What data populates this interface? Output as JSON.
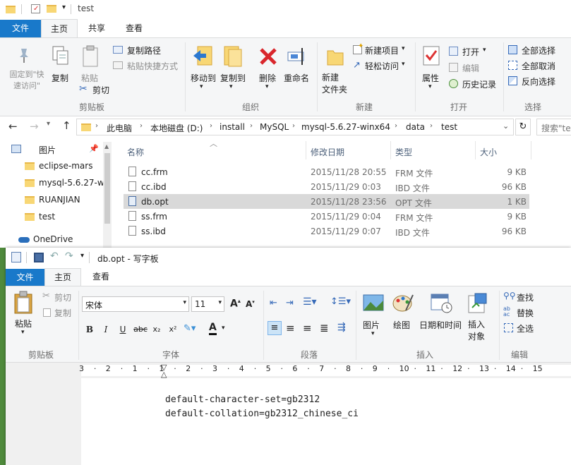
{
  "explorer": {
    "window_title": "test",
    "tabs": [
      "文件",
      "主页",
      "共享",
      "查看"
    ],
    "ribbon": {
      "clipboard": {
        "pin_label": "固定到\"快速访问\"",
        "copy_label": "复制",
        "paste_label": "粘贴",
        "copy_path_label": "复制路径",
        "paste_shortcut_label": "粘贴快捷方式",
        "cut_label": "剪切",
        "group_label": "剪贴板"
      },
      "organize": {
        "move_to_label": "移动到",
        "copy_to_label": "复制到",
        "delete_label": "删除",
        "rename_label": "重命名",
        "group_label": "组织"
      },
      "new": {
        "new_folder_label": "新建\n文件夹",
        "new_item_label": "新建项目",
        "easy_access_label": "轻松访问",
        "group_label": "新建"
      },
      "open": {
        "properties_label": "属性",
        "open_label": "打开",
        "edit_label": "编辑",
        "history_label": "历史记录",
        "group_label": "打开"
      },
      "select": {
        "select_all_label": "全部选择",
        "select_none_label": "全部取消",
        "invert_label": "反向选择",
        "group_label": "选择"
      }
    },
    "breadcrumb": [
      "此电脑",
      "本地磁盘 (D:)",
      "install",
      "MySQL",
      "mysql-5.6.27-winx64",
      "data",
      "test"
    ],
    "search_placeholder": "搜索\"te",
    "nav": [
      {
        "label": "图片",
        "pinned": true
      },
      {
        "label": "eclipse-mars"
      },
      {
        "label": "mysql-5.6.27-w"
      },
      {
        "label": "RUANJIAN"
      },
      {
        "label": "test"
      },
      {
        "label": "OneDrive"
      }
    ],
    "columns": [
      "名称",
      "修改日期",
      "类型",
      "大小"
    ],
    "files": [
      {
        "name": "cc.frm",
        "date": "2015/11/28 20:55",
        "type": "FRM 文件",
        "size": "9 KB"
      },
      {
        "name": "cc.ibd",
        "date": "2015/11/29 0:03",
        "type": "IBD 文件",
        "size": "96 KB"
      },
      {
        "name": "db.opt",
        "date": "2015/11/28 23:56",
        "type": "OPT 文件",
        "size": "1 KB"
      },
      {
        "name": "ss.frm",
        "date": "2015/11/29 0:04",
        "type": "FRM 文件",
        "size": "9 KB"
      },
      {
        "name": "ss.ibd",
        "date": "2015/11/29 0:07",
        "type": "IBD 文件",
        "size": "96 KB"
      }
    ]
  },
  "wordpad": {
    "window_title": "db.opt - 写字板",
    "tabs": [
      "文件",
      "主页",
      "查看"
    ],
    "ribbon": {
      "paste_label": "粘贴",
      "cut_label": "剪切",
      "copy_label": "复制",
      "clipboard_group": "剪贴板",
      "font_name": "宋体",
      "font_size": "11",
      "font_group": "字体",
      "bold": "B",
      "italic": "I",
      "underline": "U",
      "strike": "abc",
      "subscript": "x₂",
      "superscript": "x²",
      "paragraph_group": "段落",
      "picture_label": "图片",
      "paint_label": "绘图",
      "datetime_label": "日期和时间",
      "insert_object_label": "插入\n对象",
      "insert_group": "插入",
      "find_label": "查找",
      "replace_label": "替换",
      "select_all_label": "全选",
      "edit_group": "编辑"
    },
    "ruler_marks": [
      "3",
      "2",
      "1",
      "1",
      "2",
      "3",
      "4",
      "5",
      "6",
      "7",
      "8",
      "9",
      "10",
      "11",
      "12",
      "13",
      "14",
      "15"
    ],
    "content_lines": [
      "default-character-set=gb2312",
      "default-collation=gb2312_chinese_ci"
    ]
  },
  "colors": {
    "accent": "#1979ca",
    "ribbon_bg": "#f5f6f7",
    "selected_row": "#d9d9d9"
  }
}
